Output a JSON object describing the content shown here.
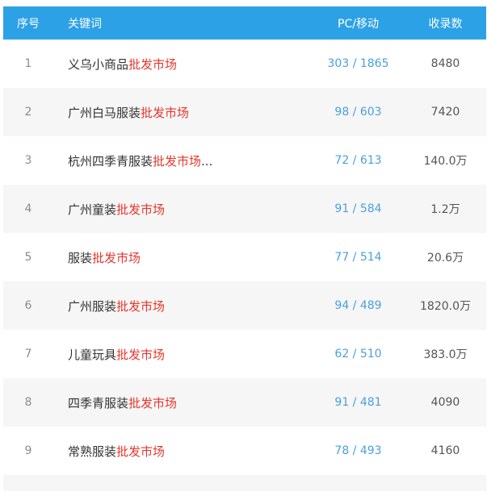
{
  "header": {
    "index": "序号",
    "keyword": "关键词",
    "pc_mobile": "PC/移动",
    "indexed": "收录数"
  },
  "colors": {
    "header_bg": "#2da1e6",
    "highlight": "#e8362c",
    "link": "#4aa0dd"
  },
  "rows": [
    {
      "index": "1",
      "prefix": "义乌小商品",
      "highlight": "批发市场",
      "suffix": "",
      "pc_mobile": "303 / 1865",
      "indexed": "8480"
    },
    {
      "index": "2",
      "prefix": "广州白马服装",
      "highlight": "批发市场",
      "suffix": "",
      "pc_mobile": "98 / 603",
      "indexed": "7420"
    },
    {
      "index": "3",
      "prefix": "杭州四季青服装",
      "highlight": "批发市场",
      "suffix": "...",
      "pc_mobile": "72 / 613",
      "indexed": "140.0万"
    },
    {
      "index": "4",
      "prefix": "广州童装",
      "highlight": "批发市场",
      "suffix": "",
      "pc_mobile": "91 / 584",
      "indexed": "1.2万"
    },
    {
      "index": "5",
      "prefix": "服装",
      "highlight": "批发市场",
      "suffix": "",
      "pc_mobile": "77 / 514",
      "indexed": "20.6万"
    },
    {
      "index": "6",
      "prefix": "广州服装",
      "highlight": "批发市场",
      "suffix": "",
      "pc_mobile": "94 / 489",
      "indexed": "1820.0万"
    },
    {
      "index": "7",
      "prefix": "儿童玩具",
      "highlight": "批发市场",
      "suffix": "",
      "pc_mobile": "62 / 510",
      "indexed": "383.0万"
    },
    {
      "index": "8",
      "prefix": "四季青服装",
      "highlight": "批发市场",
      "suffix": "",
      "pc_mobile": "91 / 481",
      "indexed": "4090"
    },
    {
      "index": "9",
      "prefix": "常熟服装",
      "highlight": "批发市场",
      "suffix": "",
      "pc_mobile": "78 / 493",
      "indexed": "4160"
    }
  ]
}
